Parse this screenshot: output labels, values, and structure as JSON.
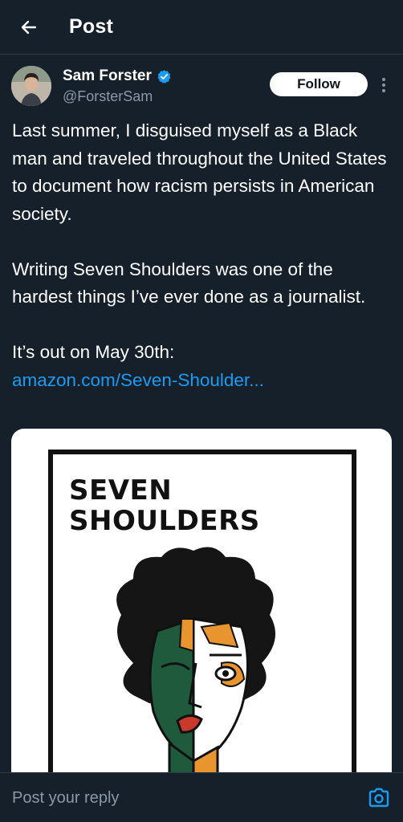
{
  "header": {
    "title": "Post",
    "back_icon": "arrow-left-icon"
  },
  "author": {
    "name": "Sam Forster",
    "handle": "@ForsterSam",
    "verified": true,
    "follow_label": "Follow"
  },
  "tweet": {
    "paragraphs": [
      "Last summer, I disguised myself as a Black man and traveled throughout the United States to document how racism persists in American society.",
      "Writing Seven Shoulders was one of the hardest things I’ve ever done as a journalist.",
      "It’s out on May 30th:"
    ],
    "link": "amazon.com/Seven-Shoulder..."
  },
  "media": {
    "cover_title": "SEVEN SHOULDERS"
  },
  "reply": {
    "placeholder": "Post your reply"
  },
  "colors": {
    "background": "#15202b",
    "link": "#1d9bf0",
    "verified": "#1d9bf0",
    "secondary_text": "#8b98a5"
  }
}
